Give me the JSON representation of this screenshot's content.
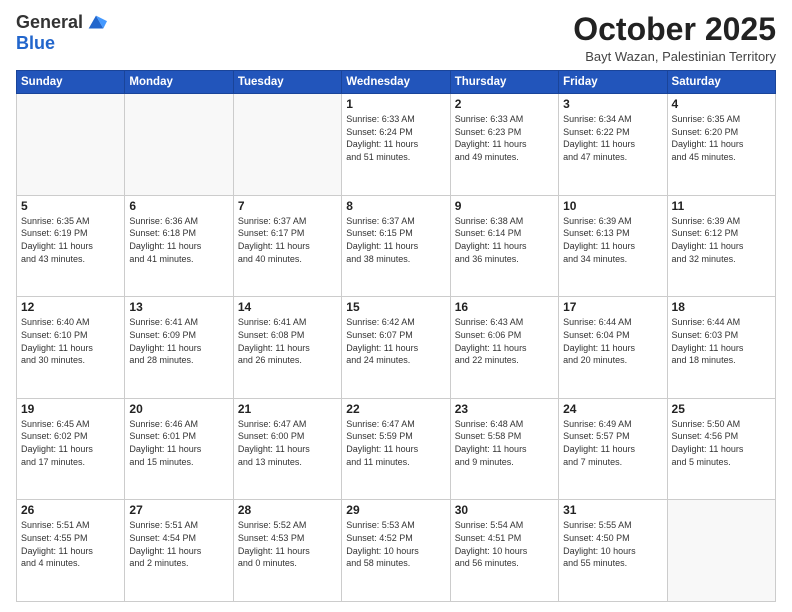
{
  "header": {
    "logo_line1": "General",
    "logo_line2": "Blue",
    "month_title": "October 2025",
    "subtitle": "Bayt Wazan, Palestinian Territory"
  },
  "weekdays": [
    "Sunday",
    "Monday",
    "Tuesday",
    "Wednesday",
    "Thursday",
    "Friday",
    "Saturday"
  ],
  "weeks": [
    [
      {
        "day": "",
        "info": ""
      },
      {
        "day": "",
        "info": ""
      },
      {
        "day": "",
        "info": ""
      },
      {
        "day": "1",
        "info": "Sunrise: 6:33 AM\nSunset: 6:24 PM\nDaylight: 11 hours\nand 51 minutes."
      },
      {
        "day": "2",
        "info": "Sunrise: 6:33 AM\nSunset: 6:23 PM\nDaylight: 11 hours\nand 49 minutes."
      },
      {
        "day": "3",
        "info": "Sunrise: 6:34 AM\nSunset: 6:22 PM\nDaylight: 11 hours\nand 47 minutes."
      },
      {
        "day": "4",
        "info": "Sunrise: 6:35 AM\nSunset: 6:20 PM\nDaylight: 11 hours\nand 45 minutes."
      }
    ],
    [
      {
        "day": "5",
        "info": "Sunrise: 6:35 AM\nSunset: 6:19 PM\nDaylight: 11 hours\nand 43 minutes."
      },
      {
        "day": "6",
        "info": "Sunrise: 6:36 AM\nSunset: 6:18 PM\nDaylight: 11 hours\nand 41 minutes."
      },
      {
        "day": "7",
        "info": "Sunrise: 6:37 AM\nSunset: 6:17 PM\nDaylight: 11 hours\nand 40 minutes."
      },
      {
        "day": "8",
        "info": "Sunrise: 6:37 AM\nSunset: 6:15 PM\nDaylight: 11 hours\nand 38 minutes."
      },
      {
        "day": "9",
        "info": "Sunrise: 6:38 AM\nSunset: 6:14 PM\nDaylight: 11 hours\nand 36 minutes."
      },
      {
        "day": "10",
        "info": "Sunrise: 6:39 AM\nSunset: 6:13 PM\nDaylight: 11 hours\nand 34 minutes."
      },
      {
        "day": "11",
        "info": "Sunrise: 6:39 AM\nSunset: 6:12 PM\nDaylight: 11 hours\nand 32 minutes."
      }
    ],
    [
      {
        "day": "12",
        "info": "Sunrise: 6:40 AM\nSunset: 6:10 PM\nDaylight: 11 hours\nand 30 minutes."
      },
      {
        "day": "13",
        "info": "Sunrise: 6:41 AM\nSunset: 6:09 PM\nDaylight: 11 hours\nand 28 minutes."
      },
      {
        "day": "14",
        "info": "Sunrise: 6:41 AM\nSunset: 6:08 PM\nDaylight: 11 hours\nand 26 minutes."
      },
      {
        "day": "15",
        "info": "Sunrise: 6:42 AM\nSunset: 6:07 PM\nDaylight: 11 hours\nand 24 minutes."
      },
      {
        "day": "16",
        "info": "Sunrise: 6:43 AM\nSunset: 6:06 PM\nDaylight: 11 hours\nand 22 minutes."
      },
      {
        "day": "17",
        "info": "Sunrise: 6:44 AM\nSunset: 6:04 PM\nDaylight: 11 hours\nand 20 minutes."
      },
      {
        "day": "18",
        "info": "Sunrise: 6:44 AM\nSunset: 6:03 PM\nDaylight: 11 hours\nand 18 minutes."
      }
    ],
    [
      {
        "day": "19",
        "info": "Sunrise: 6:45 AM\nSunset: 6:02 PM\nDaylight: 11 hours\nand 17 minutes."
      },
      {
        "day": "20",
        "info": "Sunrise: 6:46 AM\nSunset: 6:01 PM\nDaylight: 11 hours\nand 15 minutes."
      },
      {
        "day": "21",
        "info": "Sunrise: 6:47 AM\nSunset: 6:00 PM\nDaylight: 11 hours\nand 13 minutes."
      },
      {
        "day": "22",
        "info": "Sunrise: 6:47 AM\nSunset: 5:59 PM\nDaylight: 11 hours\nand 11 minutes."
      },
      {
        "day": "23",
        "info": "Sunrise: 6:48 AM\nSunset: 5:58 PM\nDaylight: 11 hours\nand 9 minutes."
      },
      {
        "day": "24",
        "info": "Sunrise: 6:49 AM\nSunset: 5:57 PM\nDaylight: 11 hours\nand 7 minutes."
      },
      {
        "day": "25",
        "info": "Sunrise: 5:50 AM\nSunset: 4:56 PM\nDaylight: 11 hours\nand 5 minutes."
      }
    ],
    [
      {
        "day": "26",
        "info": "Sunrise: 5:51 AM\nSunset: 4:55 PM\nDaylight: 11 hours\nand 4 minutes."
      },
      {
        "day": "27",
        "info": "Sunrise: 5:51 AM\nSunset: 4:54 PM\nDaylight: 11 hours\nand 2 minutes."
      },
      {
        "day": "28",
        "info": "Sunrise: 5:52 AM\nSunset: 4:53 PM\nDaylight: 11 hours\nand 0 minutes."
      },
      {
        "day": "29",
        "info": "Sunrise: 5:53 AM\nSunset: 4:52 PM\nDaylight: 10 hours\nand 58 minutes."
      },
      {
        "day": "30",
        "info": "Sunrise: 5:54 AM\nSunset: 4:51 PM\nDaylight: 10 hours\nand 56 minutes."
      },
      {
        "day": "31",
        "info": "Sunrise: 5:55 AM\nSunset: 4:50 PM\nDaylight: 10 hours\nand 55 minutes."
      },
      {
        "day": "",
        "info": ""
      }
    ]
  ]
}
